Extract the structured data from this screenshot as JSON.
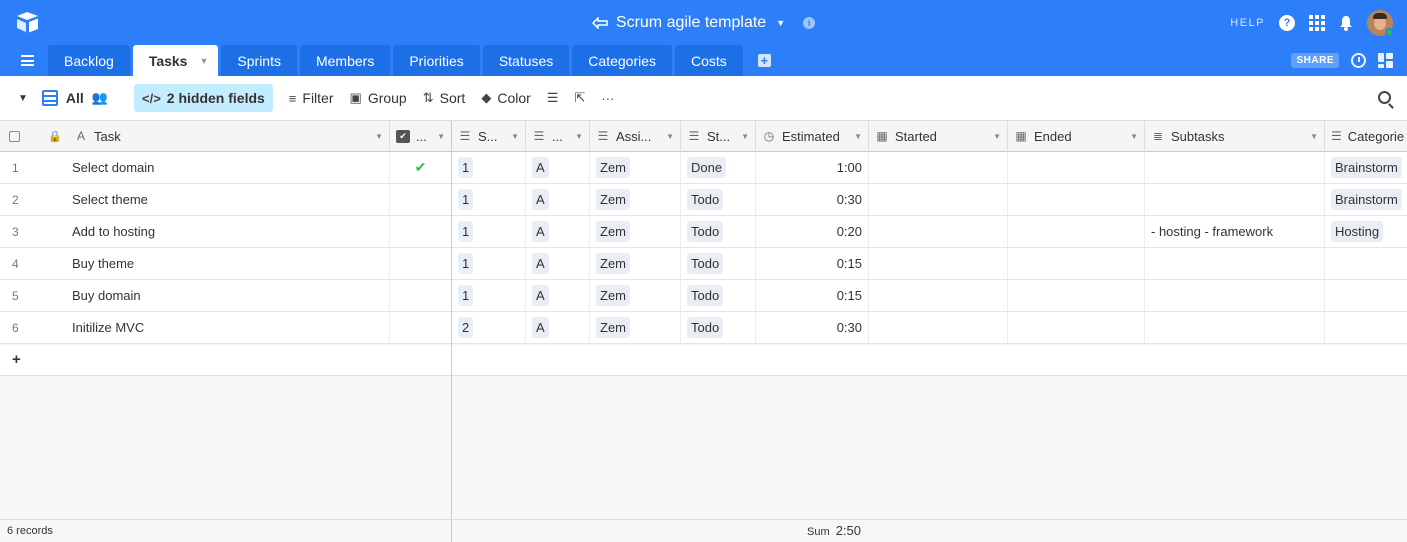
{
  "header": {
    "base_title": "Scrum agile template",
    "help_label": "HELP"
  },
  "tabs": [
    {
      "label": "Backlog"
    },
    {
      "label": "Tasks",
      "active": true
    },
    {
      "label": "Sprints"
    },
    {
      "label": "Members"
    },
    {
      "label": "Priorities"
    },
    {
      "label": "Statuses"
    },
    {
      "label": "Categories"
    },
    {
      "label": "Costs"
    }
  ],
  "share_label": "SHARE",
  "toolbar": {
    "view_name": "All",
    "hidden_fields": "2 hidden fields",
    "filter": "Filter",
    "group": "Group",
    "sort": "Sort",
    "color": "Color"
  },
  "columns": {
    "task": "Task",
    "done": "...",
    "sprint": "S...",
    "priority": "...",
    "assignee": "Assi...",
    "status": "St...",
    "estimated": "Estimated",
    "started": "Started",
    "ended": "Ended",
    "subtasks": "Subtasks",
    "categories": "Categorie"
  },
  "rows": [
    {
      "num": "1",
      "task": "Select domain",
      "done": true,
      "sprint": "1",
      "priority": "A",
      "assignee": "Zem",
      "status": "Done",
      "estimated": "1:00",
      "started": "",
      "ended": "",
      "subtasks": "",
      "category": "Brainstorm"
    },
    {
      "num": "2",
      "task": "Select theme",
      "done": false,
      "sprint": "1",
      "priority": "A",
      "assignee": "Zem",
      "status": "Todo",
      "estimated": "0:30",
      "started": "",
      "ended": "",
      "subtasks": "",
      "category": "Brainstorm"
    },
    {
      "num": "3",
      "task": "Add to hosting",
      "done": false,
      "sprint": "1",
      "priority": "A",
      "assignee": "Zem",
      "status": "Todo",
      "estimated": "0:20",
      "started": "",
      "ended": "",
      "subtasks": "- hosting - framework",
      "category": "Hosting"
    },
    {
      "num": "4",
      "task": "Buy theme",
      "done": false,
      "sprint": "1",
      "priority": "A",
      "assignee": "Zem",
      "status": "Todo",
      "estimated": "0:15",
      "started": "",
      "ended": "",
      "subtasks": "",
      "category": ""
    },
    {
      "num": "5",
      "task": "Buy domain",
      "done": false,
      "sprint": "1",
      "priority": "A",
      "assignee": "Zem",
      "status": "Todo",
      "estimated": "0:15",
      "started": "",
      "ended": "",
      "subtasks": "",
      "category": ""
    },
    {
      "num": "6",
      "task": "Initilize MVC",
      "done": false,
      "sprint": "2",
      "priority": "A",
      "assignee": "Zem",
      "status": "Todo",
      "estimated": "0:30",
      "started": "",
      "ended": "",
      "subtasks": "",
      "category": ""
    }
  ],
  "footer": {
    "records": "6 records",
    "sum_label": "Sum",
    "sum_value": "2:50"
  }
}
